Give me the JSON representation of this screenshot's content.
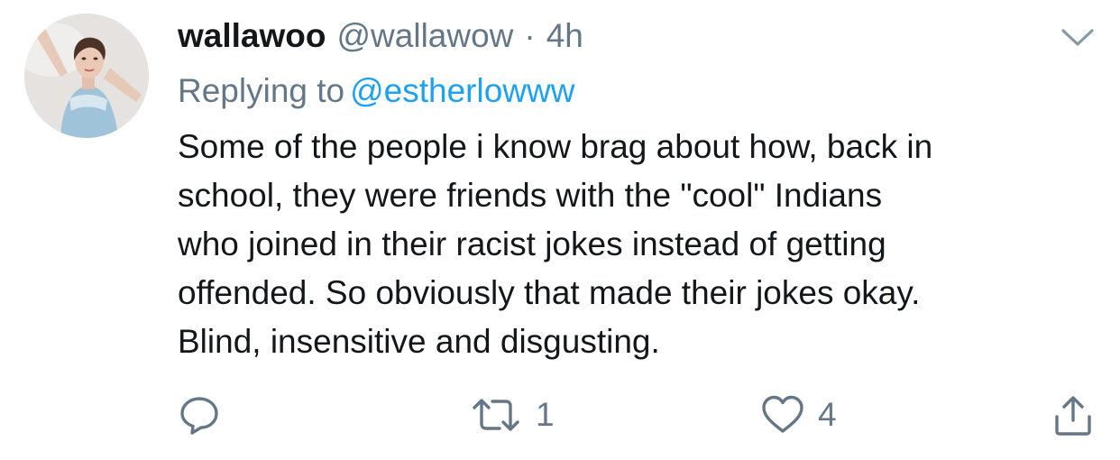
{
  "tweet": {
    "display_name": "wallawoo",
    "handle": "@wallawow",
    "separator": "·",
    "time": "4h",
    "replying_to_label": "Replying to",
    "replying_to_handle": "@estherlowww",
    "body_lines": [
      "Some of the people i know brag about how, back in",
      "school, they were friends with the \"cool\" Indians",
      "who joined in their racist jokes instead of getting",
      "offended.  So obviously that made their jokes okay.",
      "Blind, insensitive and disgusting."
    ]
  },
  "actions": {
    "reply": {
      "icon": "reply-icon",
      "count": ""
    },
    "retweet": {
      "icon": "retweet-icon",
      "count": "1"
    },
    "like": {
      "icon": "heart-icon",
      "count": "4"
    },
    "share": {
      "icon": "share-icon",
      "count": ""
    }
  },
  "colors": {
    "text_primary": "#14171a",
    "text_secondary": "#657786",
    "link": "#1da1f2",
    "background": "#ffffff"
  }
}
